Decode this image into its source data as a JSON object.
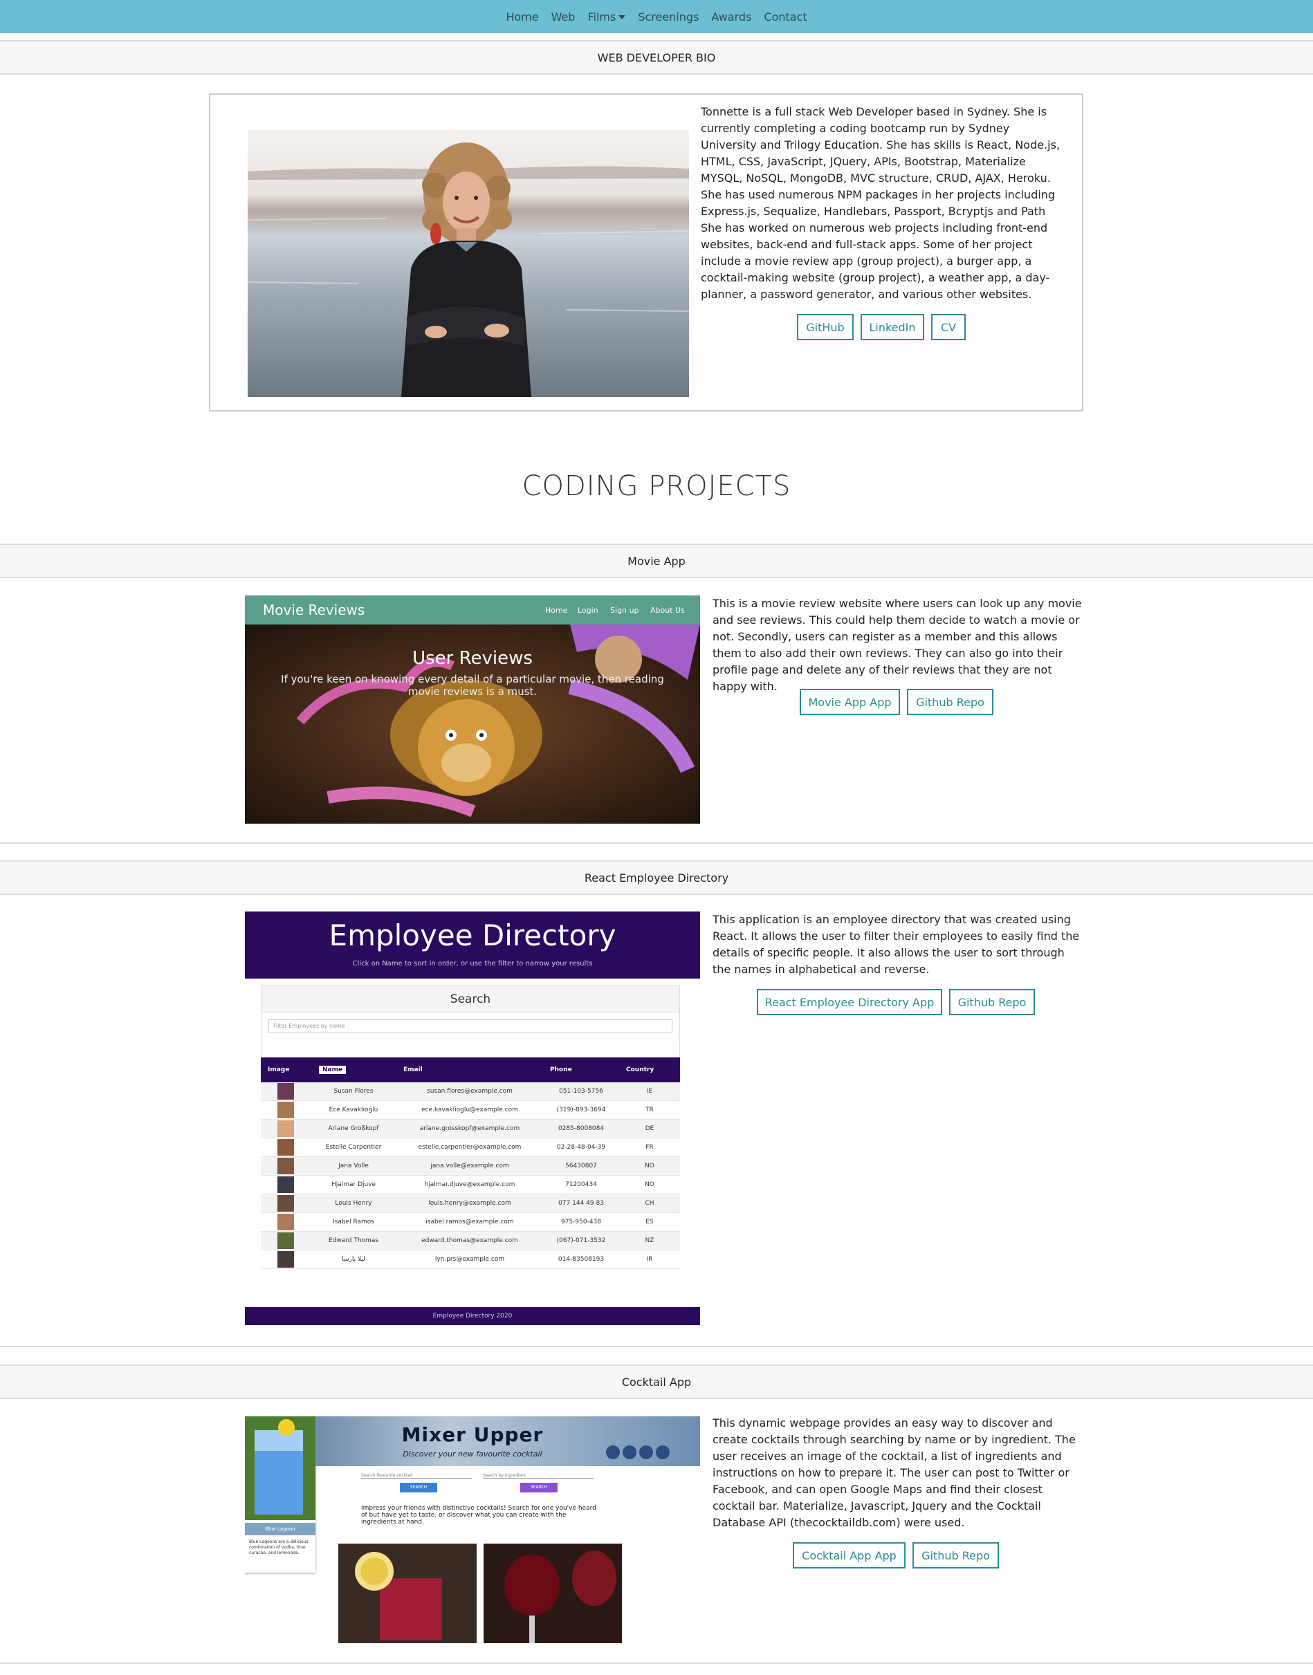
{
  "nav": {
    "items": [
      "Home",
      "Web",
      "Films",
      "Screenings",
      "Awards",
      "Contact"
    ]
  },
  "bio": {
    "header": "WEB DEVELOPER BIO",
    "text": "Tonnette is a full stack Web Developer based in Sydney. She is currently completing a coding bootcamp run by Sydney University and Trilogy Education. She has skills is React, Node.js, HTML, CSS, JavaScript, JQuery, APIs, Bootstrap, Materialize MYSQL, NoSQL, MongoDB, MVC structure, CRUD, AJAX, Heroku. She has used numerous NPM packages in her projects including Express.js, Sequalize, Handlebars, Passport, Bcryptjs and Path She has worked on numerous web projects including front-end websites, back-end and full-stack apps. Some of her project include a movie review app (group project), a burger app, a cocktail-making website (group project), a weather app, a day-planner, a password generator, and various other websites.",
    "buttons": [
      "GitHub",
      "LinkedIn",
      "CV"
    ]
  },
  "projects_heading": "CODING PROJECTS",
  "projects": [
    {
      "title": "Movie App",
      "description": "This is a movie review website where users can look up any movie and see reviews. This could help them decide to watch a movie or not. Secondly, users can register as a member and this allows them to also add their own reviews. They can also go into their profile page and delete any of their reviews that they are not happy with.",
      "buttons": [
        "Movie App App",
        "Github Repo"
      ],
      "screenshot": {
        "brand": "Movie Reviews",
        "nav": [
          "Home",
          "Login",
          "Sign up",
          "About Us"
        ],
        "heading": "User Reviews",
        "subtext": "If you're keen on knowing every detail of a particular movie, then reading movie reviews is a must."
      }
    },
    {
      "title": "React Employee Directory",
      "description": "This application is an employee directory that was created using React. It allows the user to filter their employees to easily find the details of specific people. It also allows the user to sort through the names in alphabetical and reverse.",
      "buttons": [
        "React Employee Directory App",
        "Github Repo"
      ],
      "screenshot": {
        "heading": "Employee Directory",
        "subtext": "Click on Name to sort in order, or use the filter to narrow your results",
        "search_title": "Search",
        "search_placeholder": "Filter Employees by name",
        "columns": [
          "Image",
          "Name",
          "Email",
          "Phone",
          "Country"
        ],
        "rows": [
          {
            "name": "Susan Flores",
            "email": "susan.flores@example.com",
            "phone": "051-103-5756",
            "country": "IE"
          },
          {
            "name": "Ece Kavaklıoğlu",
            "email": "ece.kavaklioglu@example.com",
            "phone": "(319)-893-3694",
            "country": "TR"
          },
          {
            "name": "Ariane Großkopf",
            "email": "ariane.grosskopf@example.com",
            "phone": "0285-8008084",
            "country": "DE"
          },
          {
            "name": "Estelle Carpentier",
            "email": "estelle.carpentier@example.com",
            "phone": "02-28-48-04-39",
            "country": "FR"
          },
          {
            "name": "Jana Volle",
            "email": "jana.volle@example.com",
            "phone": "56430807",
            "country": "NO"
          },
          {
            "name": "Hjalmar Djuve",
            "email": "hjalmar.djuve@example.com",
            "phone": "71200434",
            "country": "NO"
          },
          {
            "name": "Louis Henry",
            "email": "louis.henry@example.com",
            "phone": "077 144 49 83",
            "country": "CH"
          },
          {
            "name": "Isabel Ramos",
            "email": "isabel.ramos@example.com",
            "phone": "975-950-438",
            "country": "ES"
          },
          {
            "name": "Edward Thomas",
            "email": "edward.thomas@example.com",
            "phone": "(067)-071-3532",
            "country": "NZ"
          },
          {
            "name": "لیلا پارسا",
            "email": "lyn.prs@example.com",
            "phone": "014-83508193",
            "country": "IR"
          }
        ],
        "footer": "Employee Directory 2020"
      }
    },
    {
      "title": "Cocktail App",
      "description": "This dynamic webpage provides an easy way to discover and create cocktails through searching by name or by ingredient. The user receives an image of the cocktail, a list of ingredients and instructions on how to prepare it. The user can post to Twitter or Facebook, and can open Google Maps and find their closest cocktail bar. Materialize, Javascript, Jquery and the Cocktail Database API (thecocktaildb.com) were used.",
      "buttons": [
        "Cocktail App App",
        "Github Repo"
      ],
      "screenshot": {
        "heading": "Mixer Upper",
        "subtext": "Discover your new favourite cocktail",
        "search1": "Search favourite cocktail",
        "search2": "Search by ingredient",
        "search_btn": "SEARCH",
        "intro": "Impress your friends with distinctive cocktails! Search for one you've heard of but have yet to taste, or discover what you can create with the ingredients at hand.",
        "card_title": "Blue Lagoon",
        "card_text": "Blue Lagoons are a delicious combination of vodka, blue curacao, and lemonade."
      }
    }
  ]
}
